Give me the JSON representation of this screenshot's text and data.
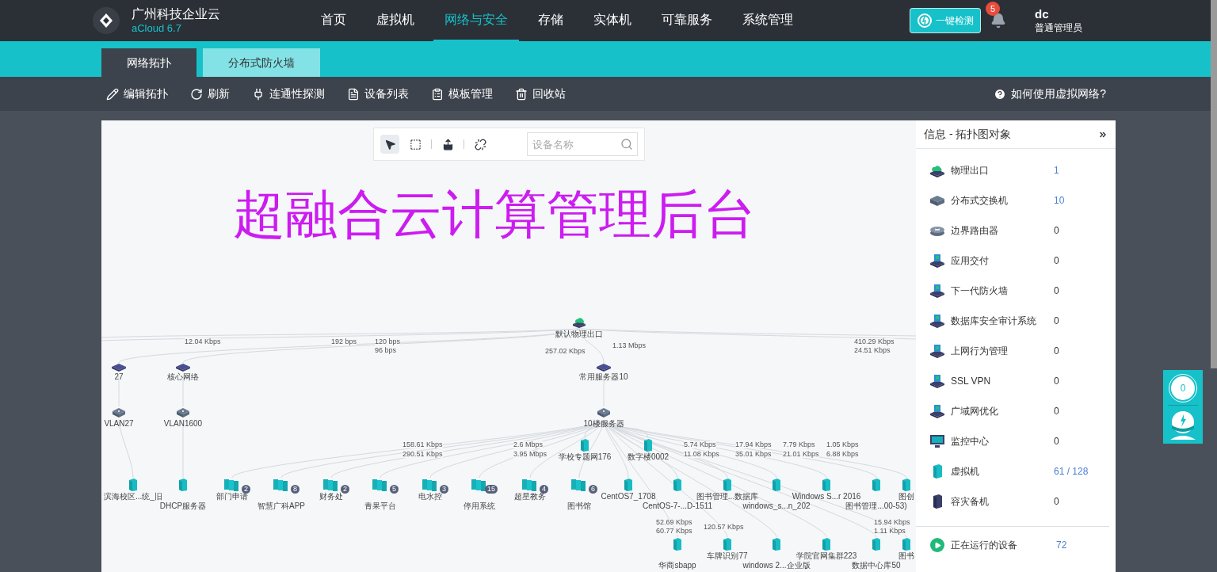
{
  "brand": {
    "name": "广州科技企业云",
    "version": "aCloud 6.7"
  },
  "nav": [
    {
      "label": "首页",
      "selected": false
    },
    {
      "label": "虚拟机",
      "selected": false
    },
    {
      "label": "网络与安全",
      "selected": true
    },
    {
      "label": "存储",
      "selected": false
    },
    {
      "label": "实体机",
      "selected": false
    },
    {
      "label": "可靠服务",
      "selected": false
    },
    {
      "label": "系统管理",
      "selected": false
    }
  ],
  "check_button": "一键检测",
  "notifications": "5",
  "user": {
    "name": "dc",
    "role": "普通管理员"
  },
  "tabs": [
    {
      "label": "网络拓扑",
      "selected": true
    },
    {
      "label": "分布式防火墙",
      "selected": false
    }
  ],
  "actions": [
    {
      "label": "编辑拓扑",
      "kind": "edit"
    },
    {
      "label": "刷新",
      "kind": "refresh"
    },
    {
      "label": "连通性探测",
      "kind": "probe"
    },
    {
      "label": "设备列表",
      "kind": "list"
    },
    {
      "label": "模板管理",
      "kind": "template"
    },
    {
      "label": "回收站",
      "kind": "trash"
    }
  ],
  "help_link": "如何使用虚拟网络?",
  "canvas_tools": [
    {
      "kind": "select",
      "selected": true
    },
    {
      "kind": "box",
      "selected": false
    },
    {
      "kind": "export",
      "selected": false
    },
    {
      "kind": "hide-links",
      "selected": false
    }
  ],
  "search": {
    "placeholder": "设备名称"
  },
  "overlay_title": "超融合云计算管理后台",
  "nodes": [
    {
      "label": "默认物理出口",
      "kind": "exit"
    },
    {
      "label": "27",
      "kind": "router"
    },
    {
      "label": "核心网络",
      "kind": "router"
    },
    {
      "label": "常用服务器10",
      "kind": "router"
    },
    {
      "label": "VLAN27",
      "kind": "switch"
    },
    {
      "label": "VLAN1600",
      "kind": "switch"
    },
    {
      "label": "10楼服务器",
      "kind": "switch"
    },
    {
      "label": "学校专题网176",
      "kind": "vm"
    },
    {
      "label": "数字楼0002",
      "kind": "vm"
    },
    {
      "label": "滨海校区...统_旧",
      "kind": "vm"
    },
    {
      "label": "DHCP服务器",
      "kind": "vm"
    },
    {
      "label": "部门申请",
      "kind": "group",
      "badge": "2"
    },
    {
      "label": "智慧广科APP",
      "kind": "group",
      "badge": "8"
    },
    {
      "label": "财务处",
      "kind": "group",
      "badge": "2"
    },
    {
      "label": "青果平台",
      "kind": "group",
      "badge": "5"
    },
    {
      "label": "电水控",
      "kind": "group",
      "badge": "3"
    },
    {
      "label": "停用系统",
      "kind": "group",
      "badge": "15"
    },
    {
      "label": "超星教务",
      "kind": "group",
      "badge": "4"
    },
    {
      "label": "图书馆",
      "kind": "group",
      "badge": "6"
    },
    {
      "label": "CentOS7_1708",
      "kind": "vm"
    },
    {
      "label": "CentOS-7-...D-1511",
      "kind": "vm"
    },
    {
      "label": "图书管理...数据库",
      "kind": "vm"
    },
    {
      "label": "windows_s...n_202",
      "kind": "vm"
    },
    {
      "label": "Windows S...r 2016",
      "kind": "vm"
    },
    {
      "label": "图书管理...00-53)",
      "kind": "vm"
    },
    {
      "label": "图创",
      "kind": "vm"
    },
    {
      "label": "华商sbapp",
      "kind": "vm"
    },
    {
      "label": "车牌识别77",
      "kind": "vm"
    },
    {
      "label": "windows 2...企业版",
      "kind": "vm"
    },
    {
      "label": "学院官网集群223",
      "kind": "vm"
    },
    {
      "label": "数据中心库50",
      "kind": "vm"
    },
    {
      "label": "图书",
      "kind": "vm"
    }
  ],
  "link_rates": [
    "12.04 Kbps",
    "192 bps",
    "120 bps",
    "96 bps",
    "410.29 Kbps",
    "24.51 Kbps",
    "1.13 Mbps",
    "257.02 Kbps",
    "158.61 Kbps",
    "290.51 Kbps",
    "2.6 Mbps",
    "3.95 Mbps",
    "5.74 Kbps",
    "11.08 Kbps",
    "17.94 Kbps",
    "7.79 Kbps",
    "1.05 Kbps",
    "35.01 Kbps",
    "21.01 Kbps",
    "6.88 Kbps",
    "52.69 Kbps",
    "60.77 Kbps",
    "120.57 Kbps",
    "15.94 Kbps",
    "1.11 Kbps"
  ],
  "info_panel": {
    "title": "信息 - 拓扑图对象",
    "items": [
      {
        "label": "物理出口",
        "count": "1",
        "kind": "exit",
        "active": true
      },
      {
        "label": "分布式交换机",
        "count": "10",
        "kind": "switch",
        "active": true
      },
      {
        "label": "边界路由器",
        "count": "0",
        "kind": "router",
        "active": false
      },
      {
        "label": "应用交付",
        "count": "0",
        "kind": "appliance",
        "active": false
      },
      {
        "label": "下一代防火墙",
        "count": "0",
        "kind": "appliance",
        "active": false
      },
      {
        "label": "数据库安全审计系统",
        "count": "0",
        "kind": "appliance",
        "active": false
      },
      {
        "label": "上网行为管理",
        "count": "0",
        "kind": "appliance",
        "active": false
      },
      {
        "label": "SSL VPN",
        "count": "0",
        "kind": "appliance",
        "active": false
      },
      {
        "label": "广域网优化",
        "count": "0",
        "kind": "appliance",
        "active": false
      },
      {
        "label": "监控中心",
        "count": "0",
        "kind": "monitor",
        "active": false
      },
      {
        "label": "虚拟机",
        "count": "61 / 128",
        "kind": "vm",
        "active": true
      },
      {
        "label": "容灾备机",
        "count": "0",
        "kind": "backup",
        "active": false
      }
    ],
    "running": {
      "label": "正在运行的设备",
      "count": "72"
    }
  },
  "float_widget": {
    "count": "0"
  }
}
